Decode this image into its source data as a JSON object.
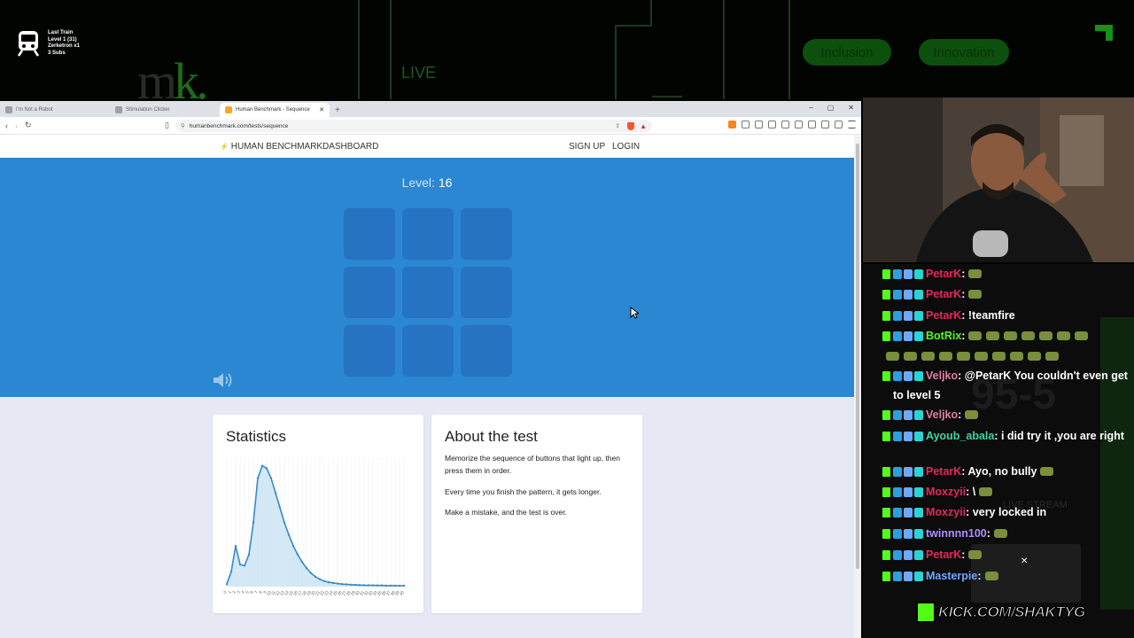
{
  "overlay": {
    "train_lines": [
      "Last Train",
      "Level 1  (31)",
      "Zerketron x1",
      "3 Subs"
    ],
    "big_letters": [
      "m",
      "k."
    ],
    "live_label": "LIVE",
    "pills": [
      "Inclusion",
      "Innovation"
    ]
  },
  "browser": {
    "tabs": [
      {
        "title": "I'm Not a Robot",
        "active": false
      },
      {
        "title": "Stimulation Clicker",
        "active": false
      },
      {
        "title": "Human Benchmark - Sequence",
        "active": true
      }
    ],
    "new_tab": "+",
    "window_controls": [
      "–",
      "▢",
      "✕"
    ],
    "url": "humanbenchmark.com/tests/sequence"
  },
  "site": {
    "brand": "HUMAN BENCHMARK",
    "nav_dashboard": "DASHBOARD",
    "nav_signup": "SIGN UP",
    "nav_login": "LOGIN",
    "level_label": "Level:",
    "level_value": "16",
    "statistics_title": "Statistics",
    "about_title": "About the test",
    "about_paragraphs": [
      "Memorize the sequence of buttons that light up, then press them in order.",
      "Every time you finish the pattern, it gets longer.",
      "Make a mistake, and the test is over."
    ],
    "colors": {
      "hero": "#2b87d1",
      "cell": "#2573c1",
      "page_bg": "#e6e8f4"
    }
  },
  "chart_data": {
    "type": "area",
    "x": [
      0,
      1,
      2,
      3,
      4,
      5,
      6,
      7,
      8,
      9,
      10,
      11,
      12,
      13,
      14,
      15,
      16,
      17,
      18,
      19,
      20,
      21,
      22,
      23,
      24,
      25,
      26,
      27,
      28,
      29,
      30,
      31,
      32,
      33,
      34,
      35,
      36,
      37,
      38,
      39,
      40
    ],
    "values": [
      2,
      12,
      33,
      18,
      17,
      26,
      52,
      88,
      98,
      96,
      88,
      76,
      64,
      52,
      42,
      33,
      26,
      20,
      15,
      11,
      8,
      6,
      4.5,
      3.5,
      3,
      2.5,
      2,
      1.8,
      1.6,
      1.4,
      1.2,
      1.1,
      1,
      1,
      0.9,
      0.9,
      0.8,
      0.8,
      0.8,
      0.7,
      0.7
    ],
    "tick_labels": [
      "0",
      "1",
      "2",
      "3",
      "4",
      "5",
      "6",
      "7",
      "8",
      "9",
      "10",
      "11",
      "12",
      "13",
      "14",
      "15",
      "16",
      "17",
      "18",
      "19",
      "20",
      "21",
      "22",
      "23",
      "24",
      "25",
      "26",
      "27",
      "28",
      "29",
      "30",
      "31",
      "32",
      "33",
      "34",
      "35",
      "36",
      "37",
      "38",
      "39",
      "40"
    ],
    "ylim": [
      0,
      105
    ],
    "grid": true,
    "line_color": "#3a8ac8",
    "fill_color": "#c9e2f2"
  },
  "chat": {
    "bg_number": "95-5",
    "bg_live": "LIVE STREAM",
    "messages": [
      {
        "user": "PetarK",
        "color": "#e8265e",
        "text": ":",
        "emotes": 1
      },
      {
        "user": "PetarK",
        "color": "#e8265e",
        "text": ":",
        "emotes": 1
      },
      {
        "user": "PetarK",
        "color": "#e8265e",
        "text": ": !teamfire",
        "emotes": 0
      },
      {
        "user": "BotRix",
        "color": "#53fc18",
        "text": ":",
        "emotes": 7
      },
      {
        "user": "",
        "color": "#ffffff",
        "text": "",
        "emotes": 10
      },
      {
        "user": "Veljko",
        "color": "#e07fa6",
        "text": ": @PetarK You couldn't even get to level 5",
        "emotes": 0
      },
      {
        "user": "Veljko",
        "color": "#e07fa6",
        "text": ":",
        "emotes": 1
      },
      {
        "user": "Ayoub_abala",
        "color": "#3fd4a3",
        "text": ": i did try it ,you are right",
        "emotes": 0
      },
      {
        "user": "PetarK",
        "color": "#e8265e",
        "text": ": Ayo, no bully",
        "emotes": 1
      },
      {
        "user": "Moxzyii",
        "color": "#e8265e",
        "text": ": \\",
        "emotes": 1
      },
      {
        "user": "Moxzyii",
        "color": "#e8265e",
        "text": ": very locked in",
        "emotes": 0
      },
      {
        "user": "twinnnn100",
        "color": "#b28cff",
        "text": ":",
        "emotes": 1
      },
      {
        "user": "PetarK",
        "color": "#e8265e",
        "text": ":",
        "emotes": 1
      },
      {
        "user": "Masterpie",
        "color": "#6fa8ff",
        "text": ":",
        "emotes": 1
      }
    ],
    "kick_url": "KICK.COM/SHAKTYG"
  }
}
